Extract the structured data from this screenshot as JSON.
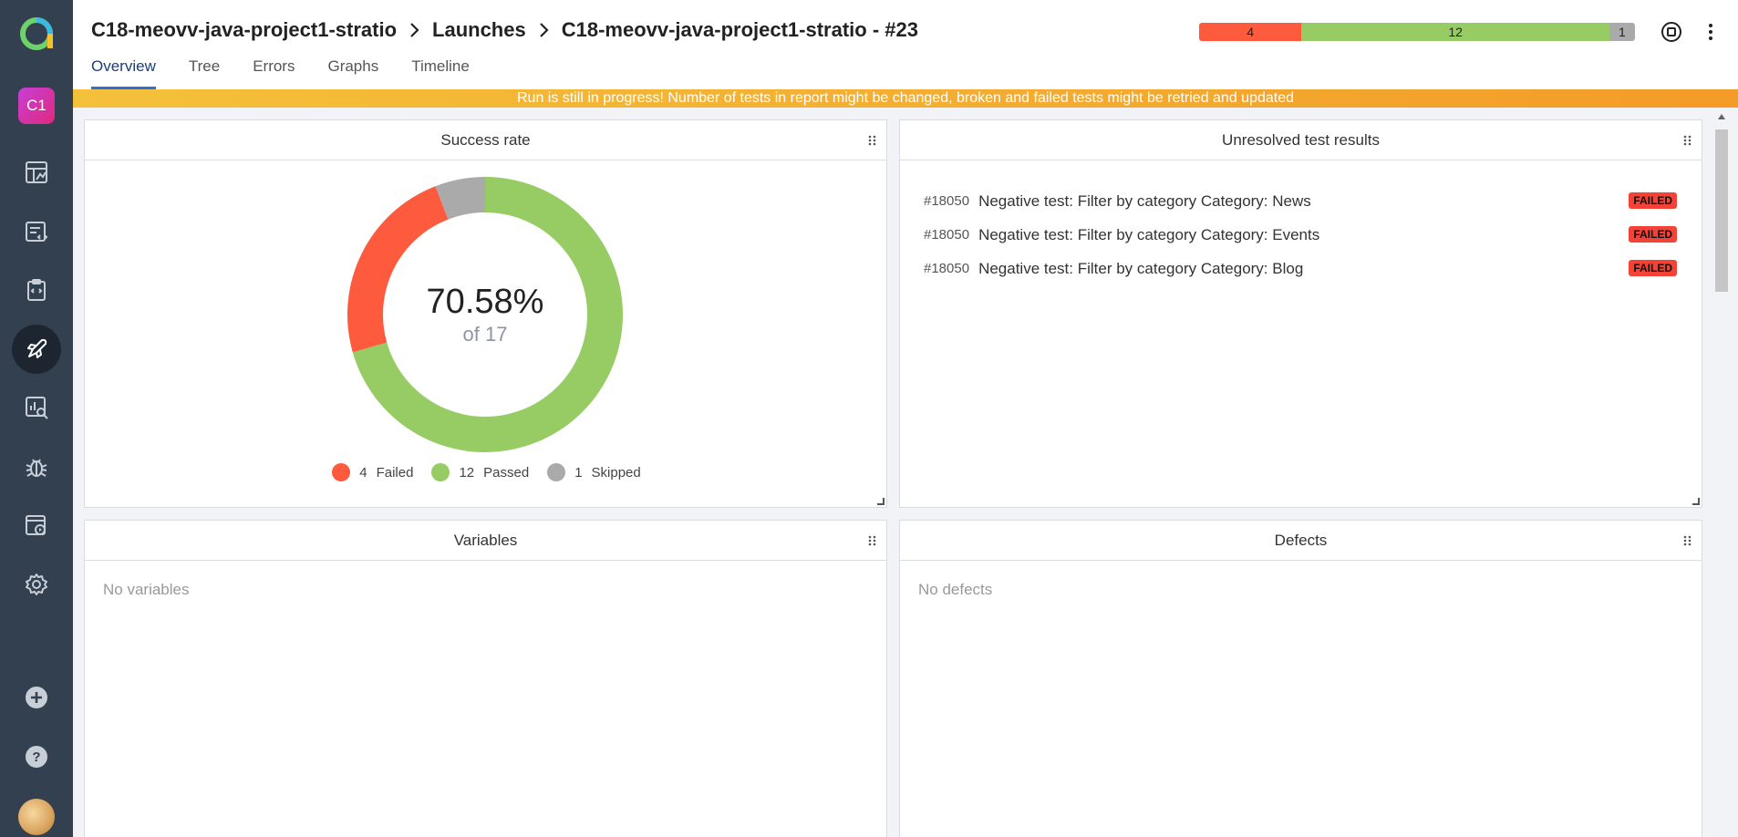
{
  "header": {
    "breadcrumb": [
      "C18-meovv-java-project1-stratio",
      "Launches",
      "C18-meovv-java-project1-stratio - #23"
    ],
    "tabs": [
      "Overview",
      "Tree",
      "Errors",
      "Graphs",
      "Timeline"
    ],
    "stats": {
      "failed": "4",
      "passed": "12",
      "skipped": "1"
    }
  },
  "sidebar": {
    "project_label": "C1",
    "icons": [
      "dashboards-icon",
      "test-cases-icon",
      "test-plans-icon",
      "launches-icon",
      "analytics-icon",
      "defects-icon",
      "jobs-icon",
      "settings-icon",
      "add-icon",
      "help-icon"
    ]
  },
  "banner": "Run is still in progress! Number of tests in report might be changed, broken and failed tests might be retried and updated",
  "widgets": {
    "success_rate": {
      "title": "Success rate",
      "percent": "70.58%",
      "of_total": "of 17",
      "legend": [
        {
          "count": "4",
          "label": "Failed",
          "color": "#fd5a3e"
        },
        {
          "count": "12",
          "label": "Passed",
          "color": "#97cc64"
        },
        {
          "count": "1",
          "label": "Skipped",
          "color": "#aaaaaa"
        }
      ]
    },
    "unresolved": {
      "title": "Unresolved test results",
      "items": [
        {
          "id": "#18050",
          "name": "Negative test: Filter by category Category: News",
          "status": "FAILED"
        },
        {
          "id": "#18050",
          "name": "Negative test: Filter by category Category: Events",
          "status": "FAILED"
        },
        {
          "id": "#18050",
          "name": "Negative test: Filter by category Category: Blog",
          "status": "FAILED"
        }
      ]
    },
    "variables": {
      "title": "Variables",
      "empty": "No variables"
    },
    "defects": {
      "title": "Defects",
      "empty": "No defects"
    }
  },
  "chart_data": {
    "type": "pie",
    "categories": [
      "Failed",
      "Passed",
      "Skipped"
    ],
    "values": [
      4,
      12,
      1
    ],
    "colors": [
      "#fd5a3e",
      "#97cc64",
      "#aaaaaa"
    ],
    "center_text": "70.58%",
    "center_subtext": "of 17"
  },
  "colors": {
    "failed": "#fd5a3e",
    "passed": "#97cc64",
    "skipped": "#aaaaaa",
    "sidebar": "#33404f",
    "accent": "#2f6fd6",
    "banner": "#f39c28"
  }
}
